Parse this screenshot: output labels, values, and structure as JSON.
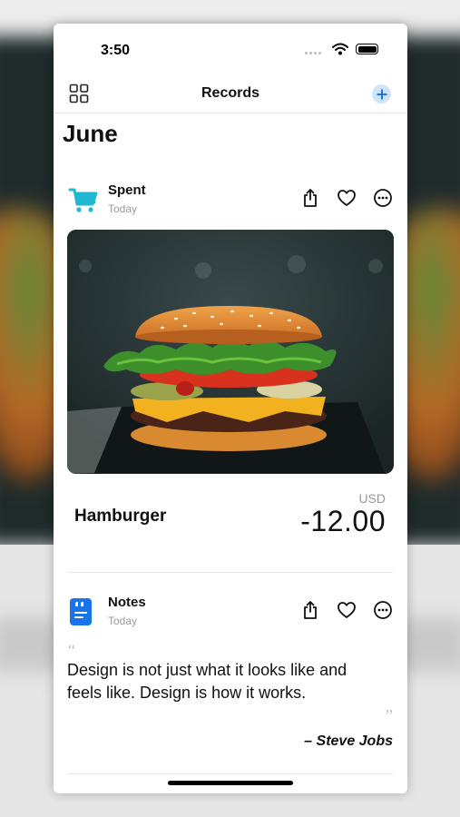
{
  "status_bar": {
    "time": "3:50"
  },
  "nav": {
    "title": "Records"
  },
  "month": "June",
  "records": [
    {
      "category": "Spent",
      "date": "Today",
      "icon": "shopping-cart-icon",
      "item": "Hamburger",
      "currency": "USD",
      "amount": "-12.00"
    },
    {
      "category": "Notes",
      "date": "Today",
      "icon": "quote-note-icon",
      "quote": "Design is not just what it looks like and feels like. Design is how it works.",
      "author": "– Steve Jobs"
    }
  ],
  "colors": {
    "accent_blue": "#1a73e8",
    "cart_teal": "#1fb8d0",
    "secondary_text": "#9a9a9a"
  }
}
